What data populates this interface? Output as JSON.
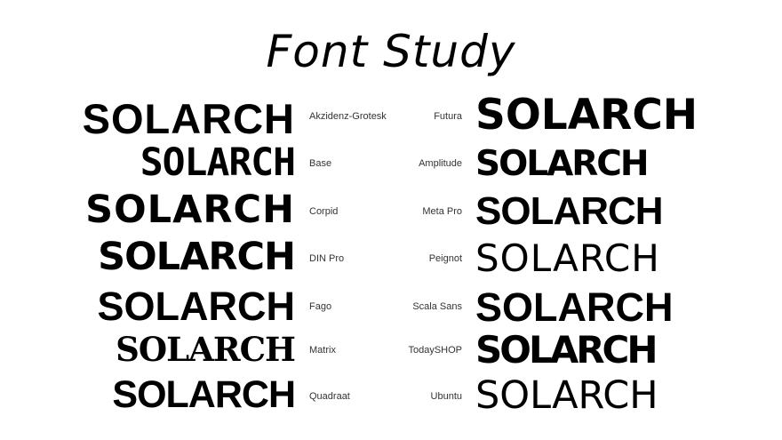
{
  "title": "Font Study",
  "sample_text": "SOLARCH",
  "left_column": [
    {
      "font": "Akzidenz-Grotesk"
    },
    {
      "font": "Base"
    },
    {
      "font": "Corpid"
    },
    {
      "font": "DIN Pro"
    },
    {
      "font": "Fago"
    },
    {
      "font": "Matrix"
    },
    {
      "font": "Quadraat"
    }
  ],
  "right_column": [
    {
      "font": "Futura"
    },
    {
      "font": "Amplitude"
    },
    {
      "font": "Meta Pro"
    },
    {
      "font": "Peignot"
    },
    {
      "font": "Scala Sans"
    },
    {
      "font": "TodaySHOP"
    },
    {
      "font": "Ubuntu"
    }
  ]
}
